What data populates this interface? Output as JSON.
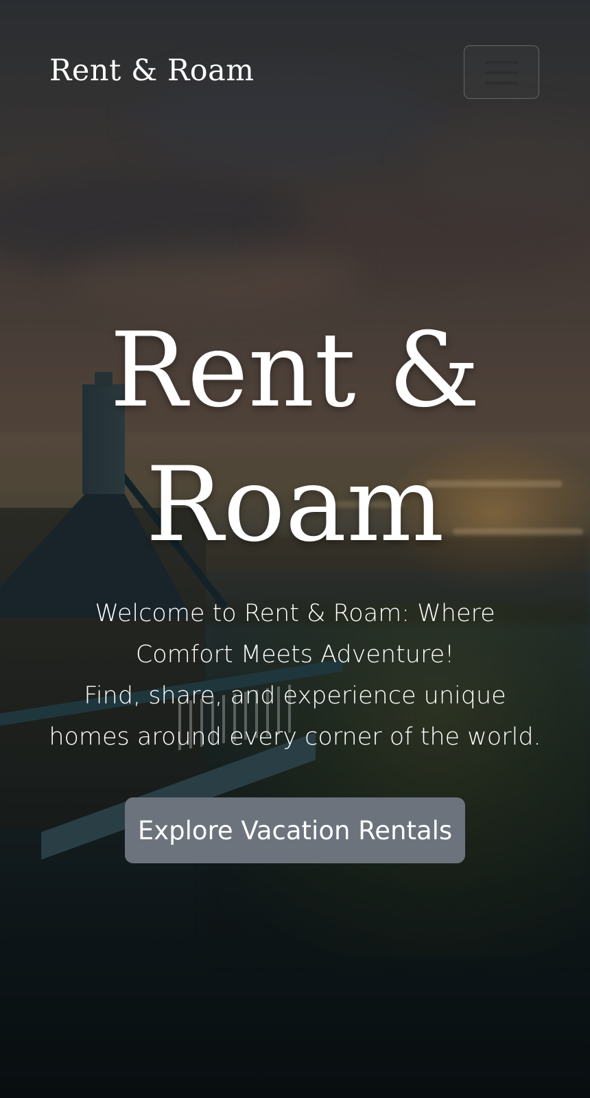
{
  "navbar": {
    "brand": "Rent & Roam",
    "toggler_icon": "hamburger-menu-icon"
  },
  "hero": {
    "title_line1": "Rent &",
    "title_line2": "Roam",
    "subtitle_line1": "Welcome to Rent & Roam: Where",
    "subtitle_line2": "Comfort Meets Adventure!",
    "subtitle_line3": "Find, share, and experience unique",
    "subtitle_line4": "homes around every corner of the world.",
    "cta_label": "Explore Vacation Rentals",
    "background_image": "seaside-house-sunset-photo"
  },
  "colors": {
    "cta_background": "#6c737c",
    "text": "#ffffff",
    "toggler_bars": "#2b2d2f"
  }
}
